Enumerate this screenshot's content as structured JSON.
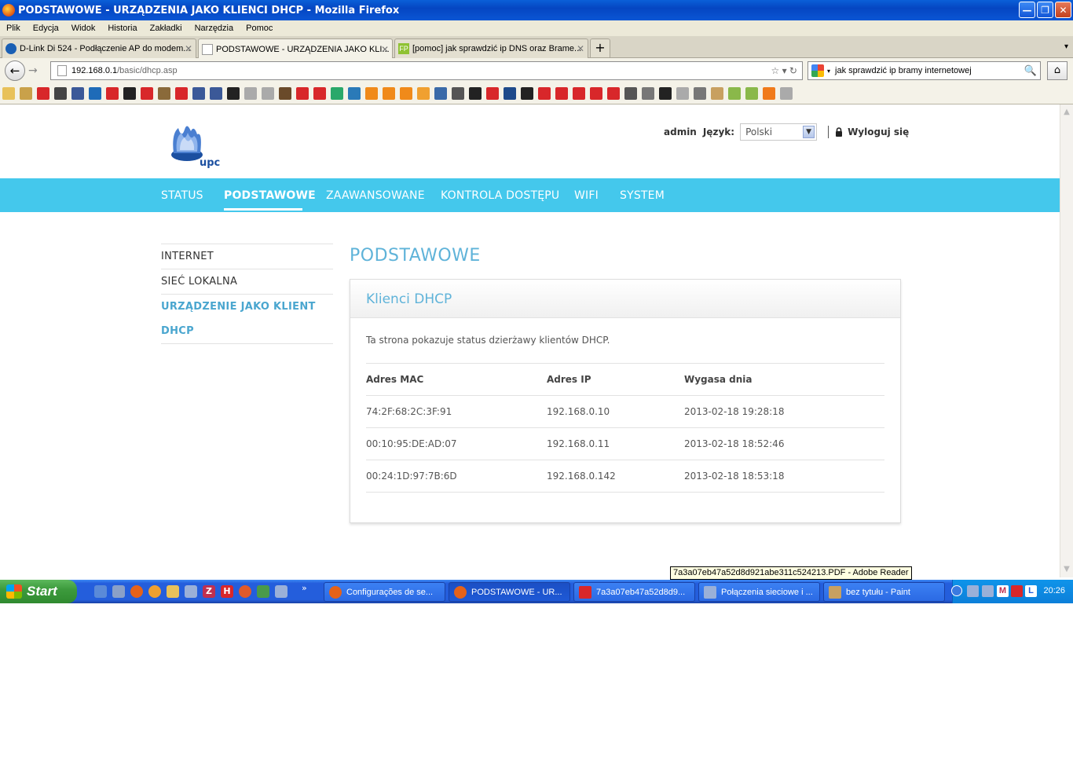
{
  "window": {
    "title": "PODSTAWOWE - URZĄDZENIA JAKO KLIENCI DHCP - Mozilla Firefox"
  },
  "menu": [
    "Plik",
    "Edycja",
    "Widok",
    "Historia",
    "Zakładki",
    "Narzędzia",
    "Pomoc"
  ],
  "tabs": [
    {
      "label": "D-Link Di 524 - Podłączenie AP do modem...",
      "icon_color": "#1a5fb4"
    },
    {
      "label": "PODSTAWOWE - URZĄDZENIA JAKO KLI...",
      "icon_color": "#ffffff"
    },
    {
      "label": "[pomoc] jak sprawdzić ip DNS oraz Brame...",
      "icon_color": "#8fc233"
    }
  ],
  "address": {
    "host": "192.168.0.1",
    "path": "/basic/dhcp.asp"
  },
  "search": {
    "value": "jak sprawdzić ip bramy internetowej"
  },
  "bookmark_colors": [
    "#e8c15a",
    "#c9a14a",
    "#d8272a",
    "#444",
    "#3b5998",
    "#1e6bb8",
    "#d8272a",
    "#222",
    "#d8272a",
    "#8a6a3a",
    "#d8272a",
    "#3b5998",
    "#3b5998",
    "#222",
    "#aaa",
    "#aaa",
    "#6a4a2a",
    "#d8272a",
    "#d8272a",
    "#2aa86a",
    "#2a7ab8",
    "#f08a1a",
    "#f08a1a",
    "#f08a1a",
    "#f0a030",
    "#3a6aa8",
    "#555",
    "#222",
    "#d8272a",
    "#1e4a8a",
    "#222",
    "#d8272a",
    "#d8272a",
    "#d8272a",
    "#d8272a",
    "#d8272a",
    "#555",
    "#777",
    "#222",
    "#aaa",
    "#777",
    "#c8a060",
    "#8ab84a",
    "#8ab84a",
    "#f07a1a",
    "#aaa"
  ],
  "page": {
    "header": {
      "logo_text": "upc",
      "user": "admin",
      "language_label": "Język:",
      "language_value": "Polski",
      "logout": "Wyloguj się"
    },
    "nav": [
      "STATUS",
      "PODSTAWOWE",
      "ZAAWANSOWANE",
      "KONTROLA DOSTĘPU",
      "WIFI",
      "SYSTEM"
    ],
    "nav_active": "PODSTAWOWE",
    "sidebar": [
      "INTERNET",
      "SIEĆ LOKALNA",
      "URZĄDZENIE JAKO KLIENT",
      "DHCP"
    ],
    "heading": "PODSTAWOWE",
    "panel": {
      "title": "Klienci DHCP",
      "description": "Ta strona pokazuje status dzierżawy klientów DHCP.",
      "columns": [
        "Adres MAC",
        "Adres IP",
        "Wygasa dnia"
      ],
      "rows": [
        [
          "74:2F:68:2C:3F:91",
          "192.168.0.10",
          "2013-02-18 19:28:18"
        ],
        [
          "00:10:95:DE:AD:07",
          "192.168.0.11",
          "2013-02-18 18:52:46"
        ],
        [
          "00:24:1D:97:7B:6D",
          "192.168.0.142",
          "2013-02-18 18:53:18"
        ]
      ]
    },
    "accent_color": "#44c8ec"
  },
  "tooltip": "7a3a07eb47a52d8d921abe311c524213.PDF - Adobe Reader",
  "taskbar": {
    "start": "Start",
    "tasks": [
      "Configurações de se...",
      "PODSTAWOWE - UR...",
      "7a3a07eb47a52d8d9...",
      "Połączenia sieciowe i ...",
      "bez tytułu - Paint"
    ],
    "clock": "20:26"
  }
}
